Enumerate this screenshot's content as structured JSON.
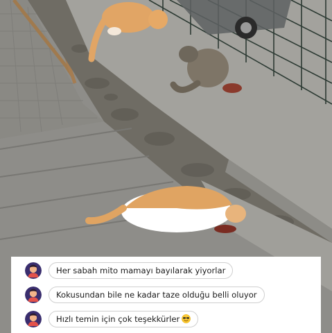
{
  "photo": {
    "subject_icon": "photo-street-cats",
    "colors": {
      "pavement": "#8f8e8a",
      "wall": "#7a776f",
      "ledge": "#a2a19c",
      "ginger": "#e0a462",
      "tabby": "#7d7467",
      "fence": "#2c3a33"
    }
  },
  "comments": [
    {
      "text": "Her sabah mito mamayı bayılarak yiyorlar",
      "avatar_icon": "avatar-icon",
      "emoji": ""
    },
    {
      "text": "Kokusundan bile ne kadar taze olduğu belli oluyor",
      "avatar_icon": "avatar-icon",
      "emoji": ""
    },
    {
      "text": "Hızlı temin için çok teşekkürler",
      "avatar_icon": "avatar-icon",
      "emoji": "smiling-face-sunglasses-icon"
    }
  ]
}
